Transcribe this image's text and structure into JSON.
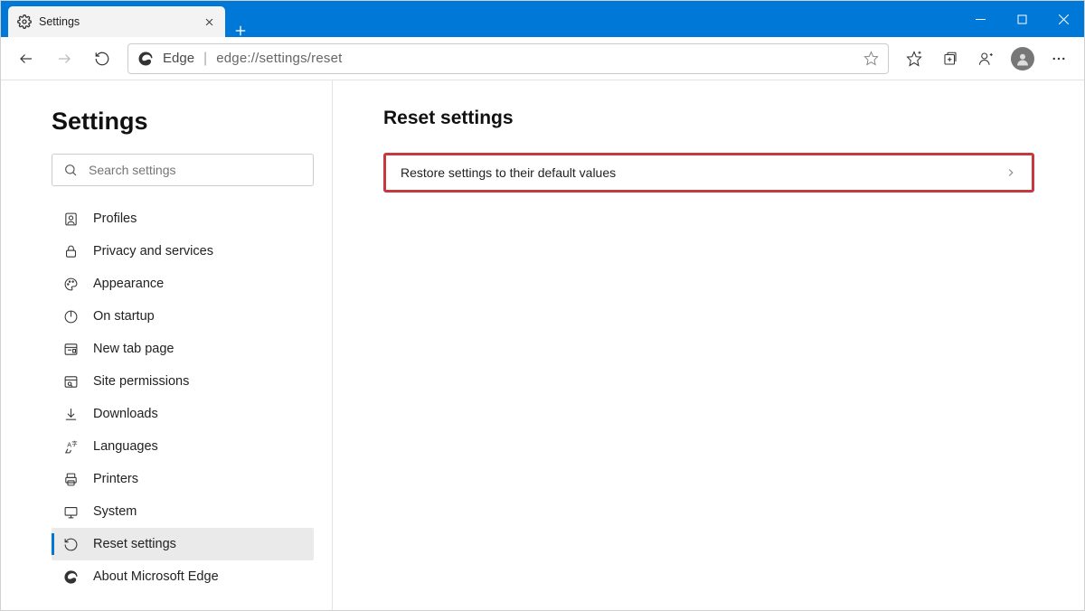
{
  "window": {
    "tab_title": "Settings"
  },
  "toolbar": {
    "address_prefix": "Edge",
    "address_url": "edge://settings/reset"
  },
  "sidebar": {
    "heading": "Settings",
    "search_placeholder": "Search settings",
    "items": [
      {
        "label": "Profiles"
      },
      {
        "label": "Privacy and services"
      },
      {
        "label": "Appearance"
      },
      {
        "label": "On startup"
      },
      {
        "label": "New tab page"
      },
      {
        "label": "Site permissions"
      },
      {
        "label": "Downloads"
      },
      {
        "label": "Languages"
      },
      {
        "label": "Printers"
      },
      {
        "label": "System"
      },
      {
        "label": "Reset settings"
      },
      {
        "label": "About Microsoft Edge"
      }
    ],
    "active_index": 10
  },
  "main": {
    "heading": "Reset settings",
    "option_label": "Restore settings to their default values"
  }
}
